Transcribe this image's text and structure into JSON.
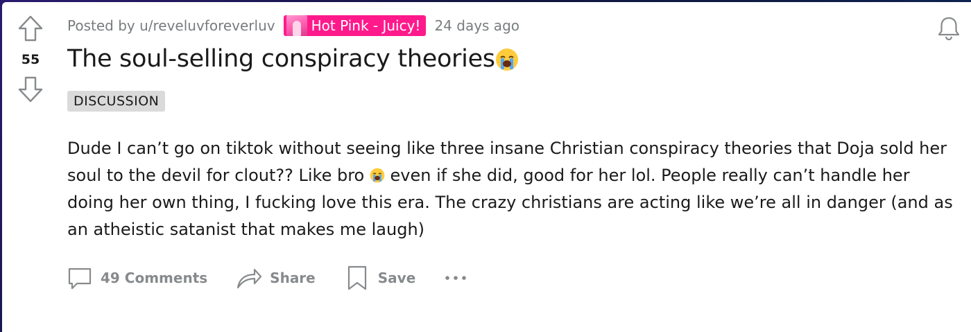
{
  "post": {
    "score": "55",
    "posted_by": "Posted by u/reveluvforeverluv",
    "flair": "Hot Pink - Juicy!",
    "time_ago": "24 days ago",
    "title": "The soul-selling conspiracy theories",
    "title_emoji": "loudly-crying-face",
    "tag": "DISCUSSION",
    "body_before_emoji": "Dude I can’t go on tiktok without seeing like three insane Christian conspiracy theories that Doja sold her soul to the devil for clout?? Like bro ",
    "body_after_emoji": " even if she did, good for her lol. People really can’t handle her doing her own thing, I fucking love this era. The crazy christians are acting like we’re all in danger (and as an atheistic satanist that makes me laugh)"
  },
  "actions": {
    "comments": "49 Comments",
    "share": "Share",
    "save": "Save"
  },
  "icons": {
    "upvote": "arrow-up-icon",
    "downvote": "arrow-down-icon",
    "notify": "bell-icon",
    "comments": "comment-bubble-icon",
    "share": "share-arrow-icon",
    "save": "bookmark-icon",
    "more": "more-dots-icon"
  },
  "colors": {
    "flair_bg": "#ff1a8c",
    "text": "#1a1a1b",
    "muted": "#878a8c"
  }
}
